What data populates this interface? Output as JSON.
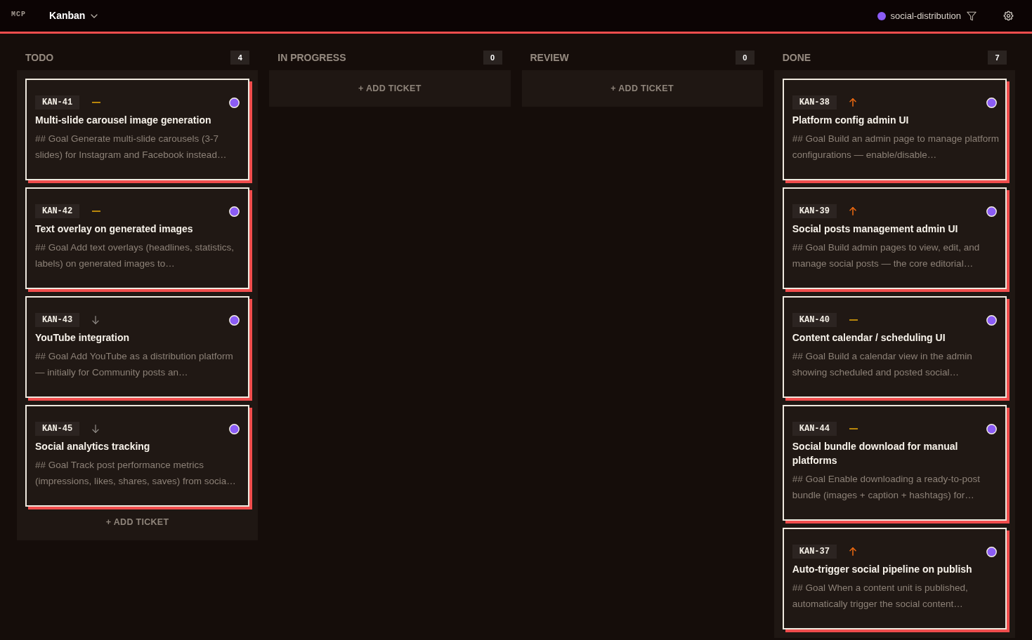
{
  "header": {
    "logo": "MCP",
    "view": "Kanban",
    "project": "social-distribution"
  },
  "columns": [
    {
      "title": "TODO",
      "count": "4",
      "tickets": [
        {
          "id": "KAN-41",
          "kind": "medium",
          "color": "#8b5cf6",
          "title": "Multi-slide carousel image generation",
          "description": "## Goal Generate multi-slide carousels (3-7 slides) for Instagram and Facebook instead…"
        },
        {
          "id": "KAN-42",
          "kind": "medium",
          "color": "#8b5cf6",
          "title": "Text overlay on generated images",
          "description": "## Goal Add text overlays (headlines, statistics, labels) on generated images to…"
        },
        {
          "id": "KAN-43",
          "kind": "low",
          "color": "#8b5cf6",
          "title": "YouTube integration",
          "description": "## Goal Add YouTube as a distribution platform — initially for Community posts an…"
        },
        {
          "id": "KAN-45",
          "kind": "low",
          "color": "#8b5cf6",
          "title": "Social analytics tracking",
          "description": "## Goal Track post performance metrics (impressions, likes, shares, saves) from socia…"
        }
      ],
      "add_label": "+ ADD TICKET"
    },
    {
      "title": "IN PROGRESS",
      "count": "0",
      "add_label": "+ ADD TICKET"
    },
    {
      "title": "REVIEW",
      "count": "0",
      "add_label": "+ ADD TICKET"
    },
    {
      "title": "DONE",
      "count": "7",
      "tickets": [
        {
          "id": "KAN-38",
          "kind": "high",
          "color": "#8b5cf6",
          "title": "Platform config admin UI",
          "description": "## Goal Build an admin page to manage platform configurations — enable/disable…"
        },
        {
          "id": "KAN-39",
          "kind": "high",
          "color": "#8b5cf6",
          "title": "Social posts management admin UI",
          "description": "## Goal Build admin pages to view, edit, and manage social posts — the core editorial…"
        },
        {
          "id": "KAN-40",
          "kind": "medium",
          "color": "#8b5cf6",
          "title": "Content calendar / scheduling UI",
          "description": "## Goal Build a calendar view in the admin showing scheduled and posted social…"
        },
        {
          "id": "KAN-44",
          "kind": "medium",
          "color": "#8b5cf6",
          "title": "Social bundle download for manual platforms",
          "description": "## Goal Enable downloading a ready-to-post bundle (images + caption + hashtags) for…"
        },
        {
          "id": "KAN-37",
          "kind": "high",
          "color": "#8b5cf6",
          "title": "Auto-trigger social pipeline on publish",
          "description": "## Goal When a content unit is published, automatically trigger the social content…"
        }
      ]
    }
  ]
}
